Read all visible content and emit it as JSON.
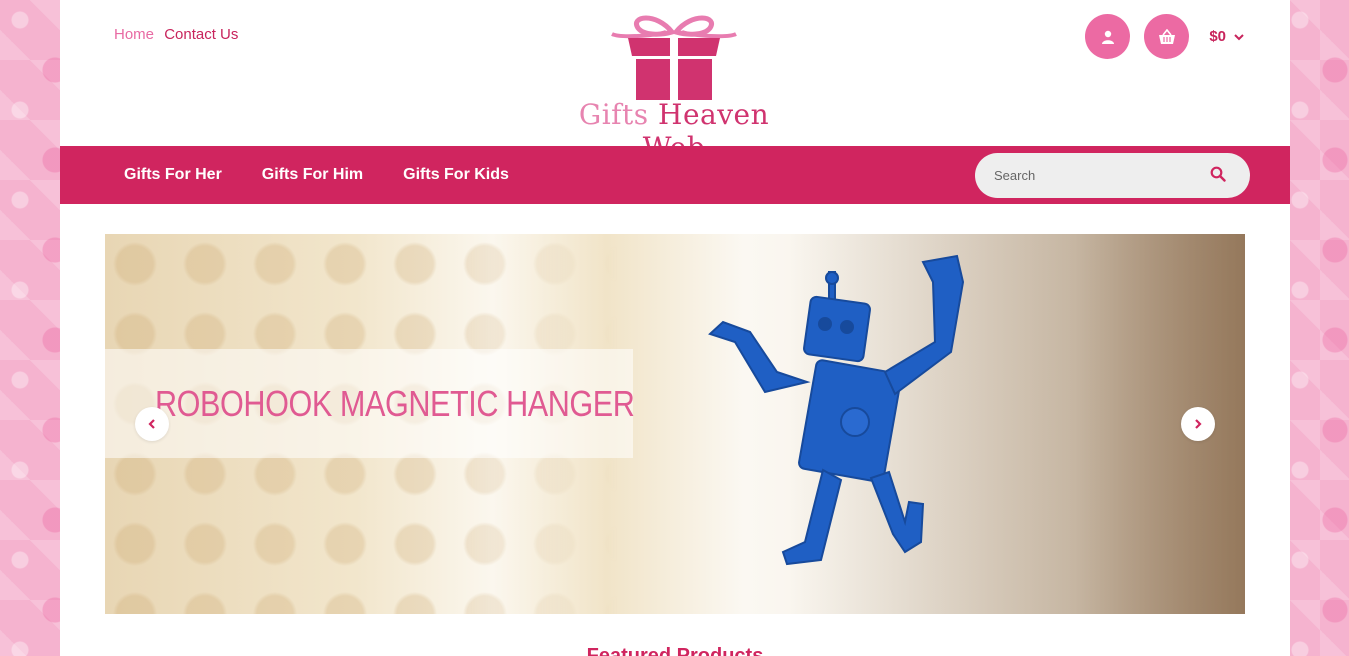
{
  "header": {
    "links": [
      {
        "label": "Home"
      },
      {
        "label": "Contact Us"
      }
    ],
    "logo": {
      "word1": "Gifts",
      "word2": "Heaven",
      "word3": "Web"
    },
    "account_icon": "user-icon",
    "cart_icon": "basket-icon",
    "cart_total": "$0"
  },
  "nav": {
    "items": [
      {
        "label": "Gifts For Her"
      },
      {
        "label": "Gifts For Him"
      },
      {
        "label": "Gifts For Kids"
      }
    ],
    "search": {
      "placeholder": "Search"
    }
  },
  "slider": {
    "caption": "ROBOHOOK MAGNETIC HANGER"
  },
  "section": {
    "title": "Featured Products"
  },
  "colors": {
    "brand": "#d0255f",
    "accent": "#ec6aa3",
    "robot": "#1f5fc4"
  }
}
